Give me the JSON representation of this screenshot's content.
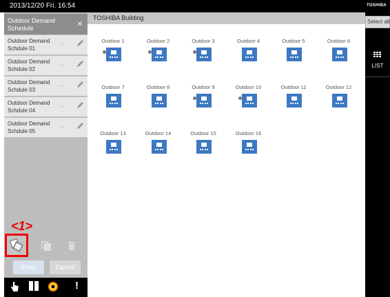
{
  "status_bar": {
    "datetime": "2013/12/20  Fri.  16:54",
    "brand": "TOSHIBA"
  },
  "sidebar": {
    "title": "Outdoor Demand Schedule",
    "close_icon": "close-icon",
    "schedules": [
      {
        "name": "Outdoor Demand Schdule 01",
        "more": "...",
        "edit_icon": "pencil-icon"
      },
      {
        "name": "Outdoor Demand Schdule 02",
        "more": "...",
        "edit_icon": "pencil-icon"
      },
      {
        "name": "Outdoor Demand Schdule 03",
        "more": "...",
        "edit_icon": "pencil-icon"
      },
      {
        "name": "Outdoor Demand Schdule 04",
        "more": "...",
        "edit_icon": "pencil-icon"
      },
      {
        "name": "Outdoor Demand Schdule 05",
        "more": "...",
        "edit_icon": "pencil-icon"
      }
    ],
    "marker": "<1>",
    "tools": {
      "add": "add-schedule-icon",
      "copy": "copy-icon",
      "delete": "trash-icon"
    },
    "enter_label": "Enter",
    "cancel_label": "Cancel"
  },
  "bottom_bar": {
    "icons": [
      "hand-pointer-icon",
      "panels-icon",
      "gear-icon",
      "alert-icon"
    ],
    "alert_glyph": "!"
  },
  "main": {
    "building": "TOSHIBA Building",
    "units": [
      {
        "label": "Outdoor 1",
        "has_indicator": true
      },
      {
        "label": "Outdoor 2",
        "has_indicator": true
      },
      {
        "label": "Outdoor 3",
        "has_indicator": true
      },
      {
        "label": "Outdoor 4",
        "has_indicator": false
      },
      {
        "label": "Outdoor 5",
        "has_indicator": false
      },
      {
        "label": "Outdoor 6",
        "has_indicator": false
      },
      {
        "label": "Outdoor 7",
        "has_indicator": false
      },
      {
        "label": "Outdoor 8",
        "has_indicator": false
      },
      {
        "label": "Outdoor 9",
        "has_indicator": true
      },
      {
        "label": "Outdoor 10",
        "has_indicator": true
      },
      {
        "label": "Outdoor 11",
        "has_indicator": false
      },
      {
        "label": "Outdoor 12",
        "has_indicator": false
      },
      {
        "label": "Outdoor 13",
        "has_indicator": false
      },
      {
        "label": "Outdoor 14",
        "has_indicator": false
      },
      {
        "label": "Outdoor 15",
        "has_indicator": false
      },
      {
        "label": "Outdoor 16",
        "has_indicator": false
      }
    ],
    "unit_icon": "outdoor-unit-icon",
    "indicator_icon": "status-dot-icon"
  },
  "right_panel": {
    "select_all": "Select all",
    "list_label": "LIST",
    "list_icon": "grid-list-icon"
  },
  "colors": {
    "accent": "#3d78c2",
    "marker": "#e00000"
  }
}
